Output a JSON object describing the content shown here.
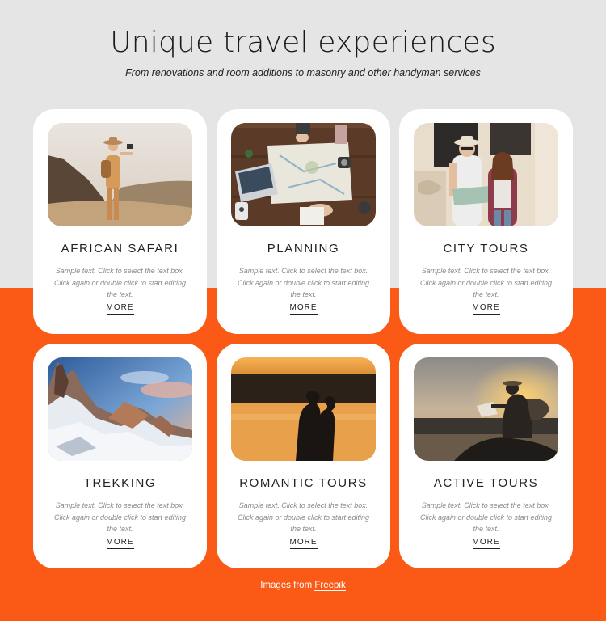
{
  "header": {
    "title": "Unique travel experiences",
    "subtitle": "From renovations and room additions to masonry and other handyman services"
  },
  "cards": [
    {
      "title": "AFRICAN SAFARI",
      "text": "Sample text. Click to select the text box. Click again or double click to start editing the text.",
      "more": "MORE"
    },
    {
      "title": "PLANNING",
      "text": "Sample text. Click to select the text box. Click again or double click to start editing the text.",
      "more": "MORE"
    },
    {
      "title": "CITY TOURS",
      "text": "Sample text. Click to select the text box. Click again or double click to start editing the text.",
      "more": "MORE"
    },
    {
      "title": "TREKKING",
      "text": "Sample text. Click to select the text box. Click again or double click to start editing the text.",
      "more": "MORE"
    },
    {
      "title": "ROMANTIC TOURS",
      "text": "Sample text. Click to select the text box. Click again or double click to start editing the text.",
      "more": "MORE"
    },
    {
      "title": "ACTIVE TOURS",
      "text": "Sample text. Click to select the text box. Click again or double click to start editing the text.",
      "more": "MORE"
    }
  ],
  "footer": {
    "credit_prefix": "Images from",
    "credit_link": "Freepik"
  },
  "colors": {
    "accent": "#fb5a16",
    "top_background": "#e5e5e5",
    "card": "#ffffff"
  }
}
